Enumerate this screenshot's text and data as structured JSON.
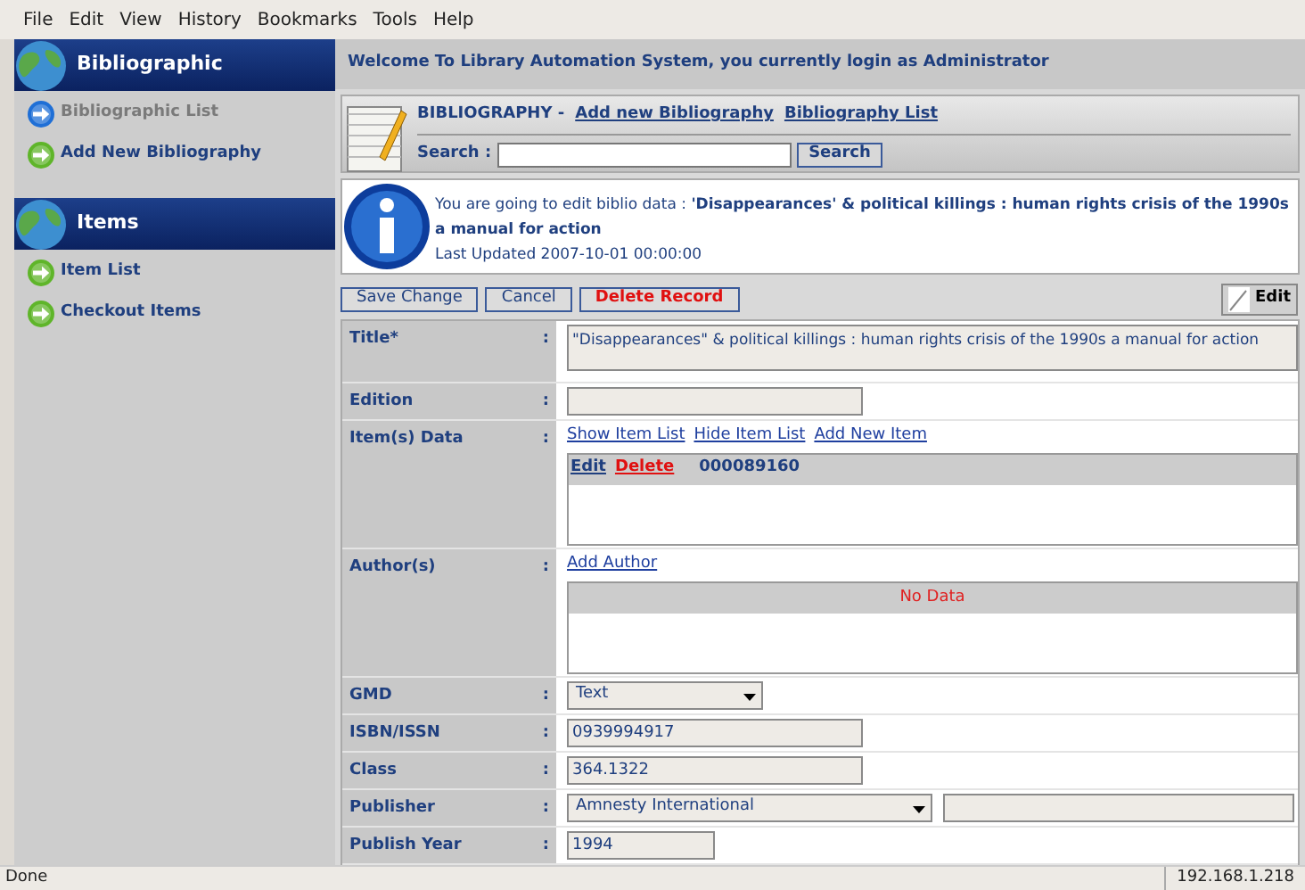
{
  "menu": [
    "File",
    "Edit",
    "View",
    "History",
    "Bookmarks",
    "Tools",
    "Help"
  ],
  "sidebar": [
    {
      "title": "Bibliographic",
      "items": [
        {
          "label": "Bibliographic List",
          "selected": true
        },
        {
          "label": "Add New Bibliography",
          "selected": false
        }
      ]
    },
    {
      "title": "Items",
      "items": [
        {
          "label": "Item List",
          "selected": false
        },
        {
          "label": "Checkout Items",
          "selected": false
        }
      ]
    }
  ],
  "welcome": "Welcome To Library Automation System, you currently login as Administrator",
  "header": {
    "title": "BIBLIOGRAPHY -",
    "links": [
      "Add new Bibliography",
      "Bibliography List"
    ],
    "search_label": "Search :",
    "search_button": "Search"
  },
  "info": {
    "message": "You are going to edit biblio data : **'Disappearances' & political killings : human rights crisis of the 1990s a manual for action**",
    "updated": "Last Updated 2007-10-01 00:00:00"
  },
  "actions": [
    {
      "label": "Save Change",
      "kind": "normal"
    },
    {
      "label": "Cancel",
      "kind": "normal"
    },
    {
      "label": "Delete Record",
      "kind": "danger"
    }
  ],
  "edit_button": "Edit",
  "fields": [
    {
      "label": "Title*",
      "colon": ":",
      "kind": "textarea",
      "value": "\"Disappearances\" & political killings  : human rights crisis of the 1990s a manual for action"
    },
    {
      "label": "Edition",
      "colon": ":",
      "kind": "text"
    },
    {
      "label": "Item(s) Data",
      "colon": ":",
      "kind": "list",
      "links": [
        "Show Item List",
        "Hide Item List",
        "Add New Item"
      ],
      "rows": [
        {
          "edit": "Edit",
          "delete": "Delete",
          "code": "000089160"
        }
      ]
    },
    {
      "label": "Author(s)",
      "colon": ":",
      "kind": "list",
      "links": [
        "Add Author"
      ],
      "empty": "No Data"
    },
    {
      "label": "GMD",
      "colon": ":",
      "kind": "select",
      "value": "Text"
    },
    {
      "label": "ISBN/ISSN",
      "colon": ":",
      "kind": "text",
      "value": "0939994917"
    },
    {
      "label": "Class",
      "colon": ":",
      "kind": "text",
      "value": "364.1322"
    },
    {
      "label": "Publisher",
      "colon": ":",
      "kind": "select_extra",
      "value": "Amnesty International"
    },
    {
      "label": "Publish Year",
      "colon": ":",
      "kind": "short",
      "value": "1994"
    }
  ],
  "status": {
    "text": "Done",
    "host": "192.168.1.218"
  }
}
